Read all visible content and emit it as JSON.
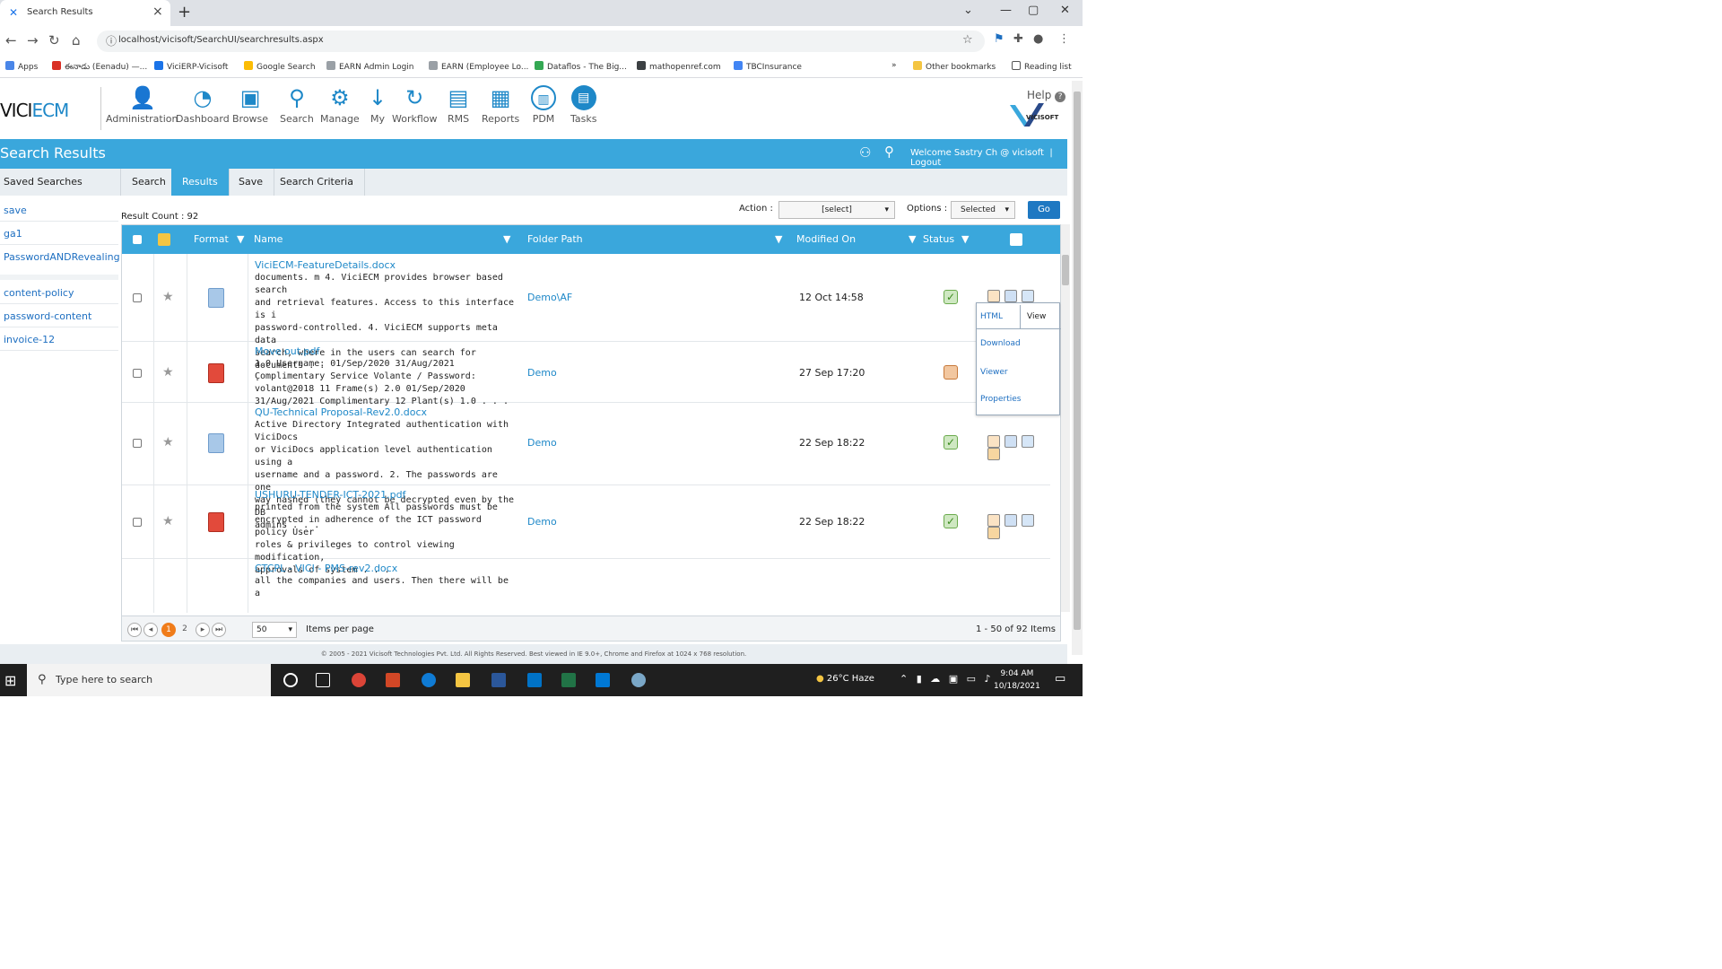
{
  "browser": {
    "tab_title": "Search Results",
    "url": "localhost/vicisoft/SearchUI/searchresults.aspx",
    "bookmarks": [
      "Apps",
      "ఈనాడు (Eenadu) —...",
      "ViciERP-Vicisoft",
      "Google Search",
      "EARN Admin Login",
      "EARN (Employee Lo...",
      "Dataflos - The Big...",
      "mathopenref.com",
      "TBCInsurance"
    ],
    "bookmarks_more": "»",
    "other_bookmarks": "Other bookmarks",
    "reading_list": "Reading list"
  },
  "app": {
    "logo_vici": "VICI",
    "logo_ecm": "ECM",
    "toolbar": [
      {
        "label": "Administration",
        "icon": "user-icon"
      },
      {
        "label": "Dashboard",
        "icon": "dashboard-icon"
      },
      {
        "label": "Browse",
        "icon": "browse-icon"
      },
      {
        "label": "Search",
        "icon": "search-icon"
      },
      {
        "label": "Manage",
        "icon": "gear-icon"
      },
      {
        "label": "My",
        "icon": "arrow-down-icon"
      },
      {
        "label": "Workflow",
        "icon": "workflow-icon"
      },
      {
        "label": "RMS",
        "icon": "rms-icon"
      },
      {
        "label": "Reports",
        "icon": "reports-icon"
      },
      {
        "label": "PDM",
        "icon": "pdm-icon"
      },
      {
        "label": "Tasks",
        "icon": "tasks-icon"
      }
    ],
    "help": "Help",
    "brand": "VICISOFT",
    "page_title": "Search Results",
    "welcome": "Welcome Sastry Ch @ vicisoft",
    "logout": "Logout",
    "accent": "#3aa7dc"
  },
  "subtabs": [
    "Saved Searches",
    "Search",
    "Results",
    "Save",
    "Search Criteria"
  ],
  "saved_searches": [
    "save",
    "ga1",
    "PasswordANDRevealing",
    "content-policy",
    "password-content",
    "invoice-12"
  ],
  "results": {
    "count_label": "Result Count : 92",
    "action_label": "Action :",
    "action_value": "[select]",
    "options_label": "Options :",
    "options_value": "Selected",
    "go": "Go",
    "columns": [
      "Format",
      "Name",
      "Folder Path",
      "Modified On",
      "Status"
    ],
    "rows": [
      {
        "name": "ViciECM-FeatureDetails.docx",
        "format": "doc",
        "snippet": [
          "documents. m 4. ViciECM provides browser based search",
          "and retrieval features. Access to this interface is i",
          "password-controlled. 4. ViciECM supports meta data",
          "search, where in the users can search for documents . .",
          "."
        ],
        "folder": "Demo\\AF",
        "modified": "12 Oct 14:58",
        "status": "ok"
      },
      {
        "name": "Move out.pdf",
        "format": "pdf",
        "snippet": [
          "1.0 Username: 01/Sep/2020 31/Aug/2021",
          "Complimentary Service Volante / Password:",
          "volant@2018 11 Frame(s) 2.0 01/Sep/2020",
          "31/Aug/2021 Complimentary 12 Plant(s) 1.0 . . ."
        ],
        "folder": "Demo",
        "modified": "27 Sep 17:20",
        "status": "workflow"
      },
      {
        "name": "QU-Technical Proposal-Rev2.0.docx",
        "format": "doc",
        "snippet": [
          "Active Directory Integrated authentication with ViciDocs",
          "or ViciDocs application level authentication using a",
          "username and a password. 2. The passwords are one",
          "way hashed (they cannot be decrypted even by the DB",
          "admins . . ."
        ],
        "folder": "Demo",
        "modified": "22 Sep 18:22",
        "status": "ok"
      },
      {
        "name": "USHURU-TENDER-ICT-2021.pdf",
        "format": "pdf",
        "snippet": [
          "printed from the system All passwords must be",
          "encrypted in adherence of the ICT password policy User",
          "roles & privileges to control viewing modification,",
          "approvals of system . . ."
        ],
        "folder": "Demo",
        "modified": "22 Sep 18:22",
        "status": "ok"
      },
      {
        "name": "CTCPL - VICI - PMS-rev2.docx",
        "format": "doc",
        "snippet": [
          "all the companies and users. Then there will be a"
        ],
        "folder": "",
        "modified": "",
        "status": ""
      }
    ],
    "popup": {
      "html": "HTML",
      "view": "View",
      "download": "Download",
      "viewer": "Viewer",
      "properties": "Properties"
    },
    "pager": {
      "pages": [
        "1",
        "2"
      ],
      "per_page": "50",
      "items_per_page": "Items per page",
      "range": "1 - 50 of 92 Items"
    }
  },
  "footer": "© 2005 - 2021 Vicisoft Technologies Pvt. Ltd. All Rights Reserved. Best viewed in IE 9.0+, Chrome and Firefox at 1024 x 768 resolution.",
  "taskbar": {
    "search_placeholder": "Type here to search",
    "weather": "26°C Haze",
    "time": "9:04 AM",
    "date": "10/18/2021"
  }
}
